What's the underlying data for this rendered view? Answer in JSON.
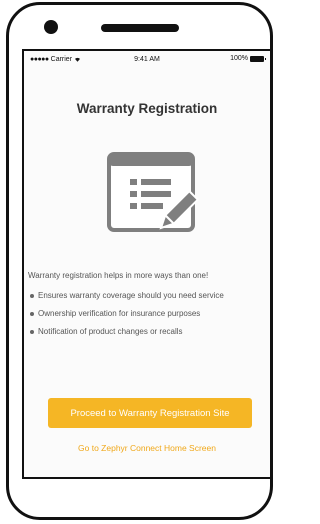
{
  "status_bar": {
    "carrier": "Carrier",
    "time": "9:41 AM",
    "battery": "100%"
  },
  "page": {
    "title": "Warranty Registration",
    "intro": "Warranty registration helps in more ways than one!",
    "bullets": [
      "Ensures warranty coverage should you need service",
      "Ownership verification for insurance purposes",
      "Notification of product changes or recalls"
    ]
  },
  "actions": {
    "primary_label": "Proceed to Warranty Registration Site",
    "secondary_label": "Go to Zephyr Connect Home Screen"
  },
  "colors": {
    "accent": "#f5b625",
    "link": "#f0a81a",
    "icon": "#7f7f7f"
  },
  "icons": [
    "document-edit-icon",
    "wifi-icon",
    "battery-icon",
    "camera-icon",
    "speaker-icon"
  ]
}
